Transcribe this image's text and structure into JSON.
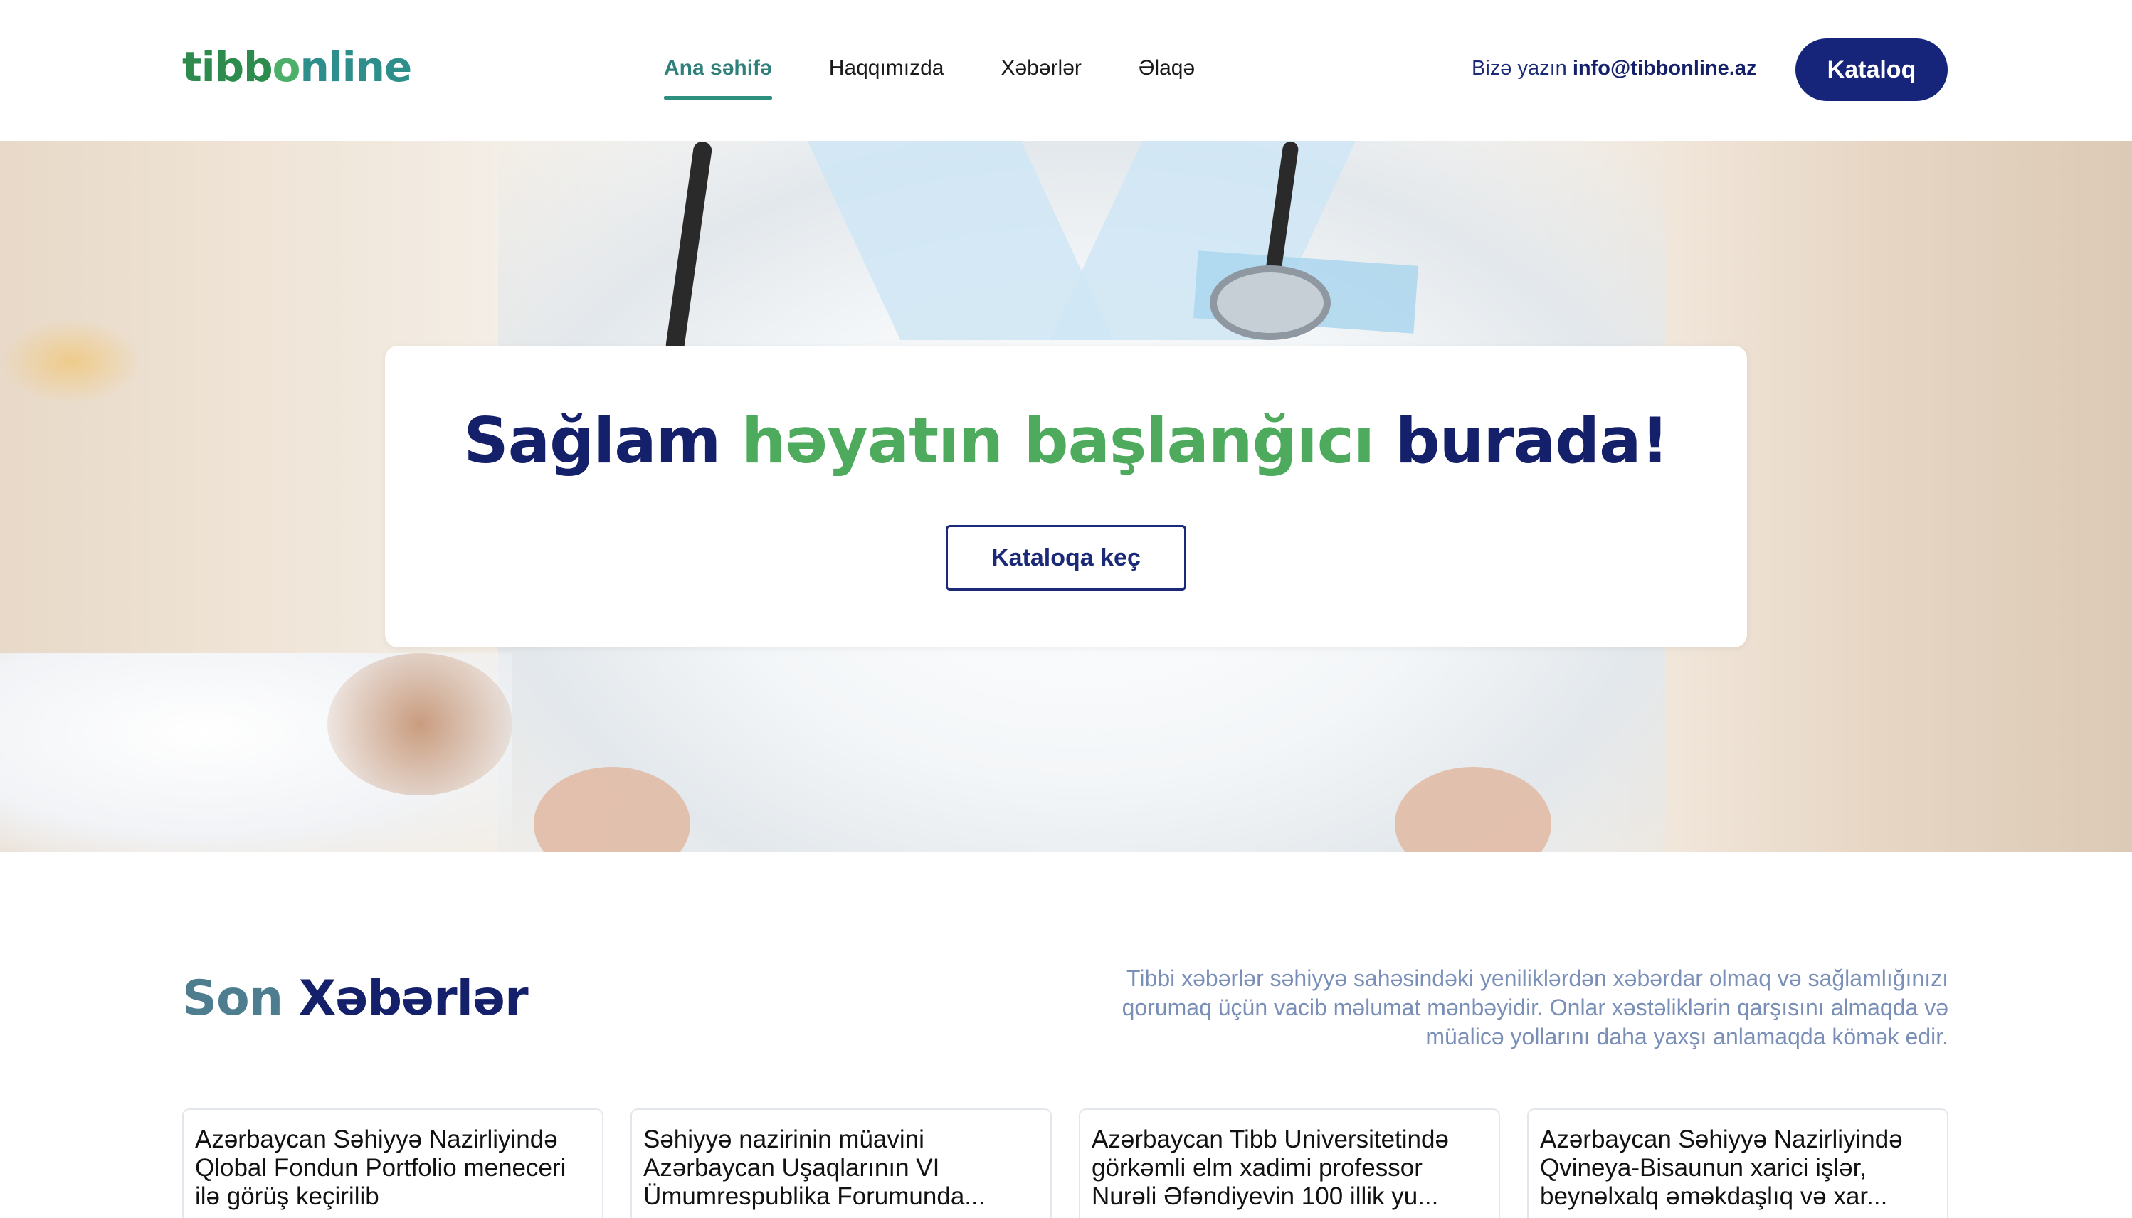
{
  "header": {
    "logo": {
      "part1": "tibb",
      "part2": "o",
      "part3": "nline"
    },
    "nav": [
      {
        "label": "Ana səhifə",
        "active": true
      },
      {
        "label": "Haqqımızda",
        "active": false
      },
      {
        "label": "Xəbərlər",
        "active": false
      },
      {
        "label": "Əlaqə",
        "active": false
      }
    ],
    "contact_prefix": "Bizə yazın",
    "contact_email": "info@tibbonline.az",
    "catalog_button": "Kataloq"
  },
  "hero": {
    "title_part1": "Sağlam",
    "title_part2": "həyatın başlanğıcı",
    "title_part3": "burada!",
    "button": "Kataloqa keç"
  },
  "news": {
    "title_part1": "Son",
    "title_part2": "Xəbərlər",
    "description": "Tibbi xəbərlər səhiyyə sahəsindəki yeniliklərdən xəbərdar olmaq və sağlamlığınızı qorumaq üçün vacib məlumat mənbəyidir. Onlar xəstəliklərin qarşısını almaqda və müalicə yollarını daha yaxşı anlamaqda kömək edir.",
    "cards": [
      {
        "title": "Azərbaycan Səhiyyə Nazirliyində Qlobal Fondun Portfolio meneceri ilə görüş keçirilib"
      },
      {
        "title": "Səhiyyə nazirinin müavini Azərbaycan Uşaqlarının VI Ümumrespublika Forumunda..."
      },
      {
        "title": "Azərbaycan Tibb Universitetində görkəmli elm xadimi professor Nurəli Əfəndiyevin 100 illik yu..."
      },
      {
        "title": "Azərbaycan Səhiyyə Nazirliyində Qvineya-Bisaunun xarici işlər, beynəlxalq əməkdaşlıq və xar..."
      }
    ]
  },
  "colors": {
    "brand_navy": "#15206a",
    "brand_green": "#4eaa5c",
    "nav_active": "#2f7f7a"
  }
}
